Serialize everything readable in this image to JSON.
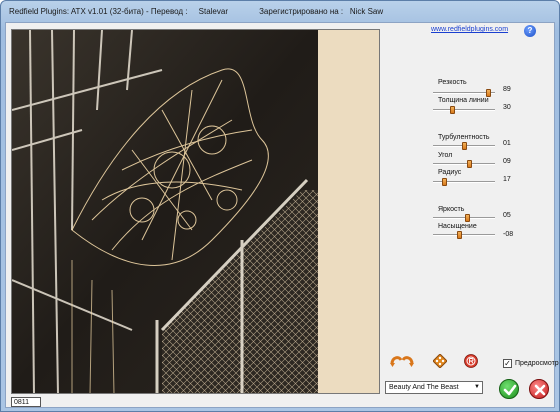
{
  "window": {
    "title": "Redfield Plugins: ATX v1.01 (32-бита) - Перевод :     Stalevar              Зарегистрировано на :   Nick Saw"
  },
  "header": {
    "site_link": "www.redfieldplugins.com",
    "help_symbol": "?"
  },
  "sliders": [
    {
      "label": "Резкость",
      "value": "89",
      "level": 0.89
    },
    {
      "label": "Толщина линии",
      "value": "30",
      "level": 0.3
    },
    {
      "label": "Турбулентность",
      "value": "01",
      "level": 0.5
    },
    {
      "label": "Угол",
      "value": "09",
      "level": 0.58
    },
    {
      "label": "Радиус",
      "value": "17",
      "level": 0.17
    },
    {
      "label": "Яркость",
      "value": "05",
      "level": 0.55
    },
    {
      "label": "Насыщение",
      "value": "-08",
      "level": 0.42
    }
  ],
  "footer": {
    "preview_label": "Предросмотр",
    "preview_checked": true,
    "check_mark": "✓",
    "preset": "Beauty And The Beast",
    "status_value": "0811"
  },
  "colors": {
    "accent_orange": "#e07a1a",
    "ok_green": "#2aa12a",
    "cancel_red": "#d02020",
    "link_blue": "#1a3fd0"
  },
  "icons": [
    "undo-redo-icon",
    "randomize-diamond-icon",
    "reset-icon",
    "help-icon",
    "ok-check-icon",
    "cancel-x-icon"
  ]
}
